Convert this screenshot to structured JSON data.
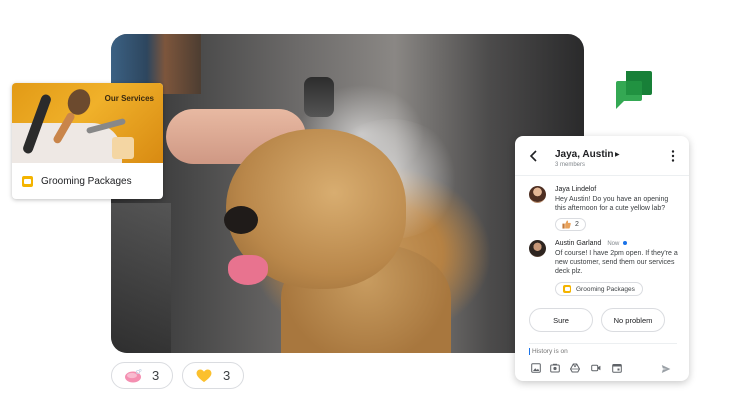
{
  "services_card": {
    "thumbnail_label": "Our Services",
    "title": "Grooming Packages",
    "icon": "slides-icon"
  },
  "chat": {
    "title": "Jaya, Austin",
    "members": "3 members",
    "messages": [
      {
        "sender": "Jaya Lindelof",
        "text": "Hey Austin! Do you have an opening this afternoon for a cute yellow lab?",
        "reaction_emoji": "thumbs-up",
        "reaction_count": "2"
      },
      {
        "sender": "Austin Garland",
        "time": "Now",
        "text": "Of course! I have 2pm open. If they're a new customer, send them our services deck plz.",
        "attachment": "Grooming Packages"
      }
    ],
    "quick_replies": [
      "Sure",
      "No problem"
    ],
    "compose_placeholder": "History is on"
  },
  "reactions": [
    {
      "emoji": "soap",
      "count": "3"
    },
    {
      "emoji": "yellow-heart",
      "count": "3"
    }
  ],
  "colors": {
    "chat_green": "#34a853",
    "chat_green_dark": "#188038",
    "slides_yellow": "#f4b400",
    "accent_blue": "#1a73e8",
    "soap_pink": "#f48fb1",
    "heart_yellow": "#fbc02d"
  }
}
